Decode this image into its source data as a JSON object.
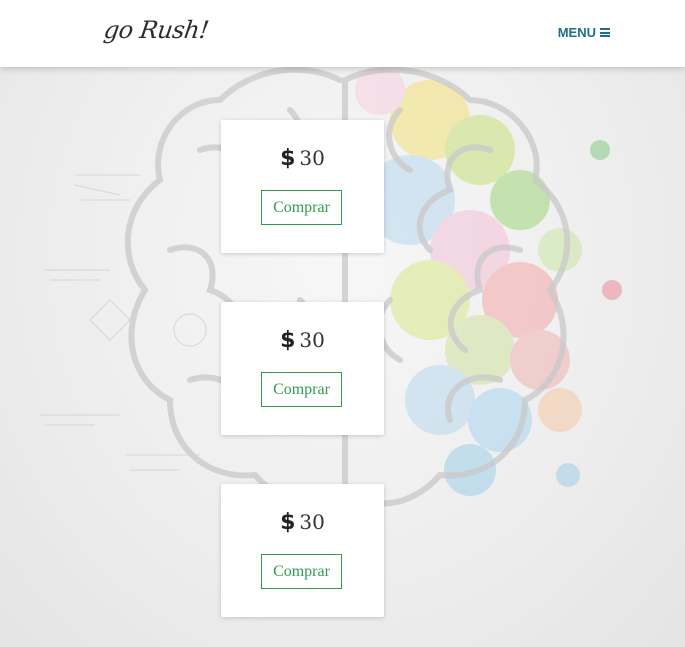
{
  "header": {
    "logo_text": "go Rush!",
    "menu_label": "MENU",
    "menu_icon": "hamburger-icon",
    "menu_color": "#1e6f8c"
  },
  "products": [
    {
      "currency_icon": "dollar-icon",
      "price": "30",
      "button_label": "Comprar"
    },
    {
      "currency_icon": "dollar-icon",
      "price": "30",
      "button_label": "Comprar"
    },
    {
      "currency_icon": "dollar-icon",
      "price": "30",
      "button_label": "Comprar"
    }
  ],
  "colors": {
    "accent_green": "#2e9e4e",
    "header_bg": "#ffffff",
    "page_bg": "#ececec"
  }
}
